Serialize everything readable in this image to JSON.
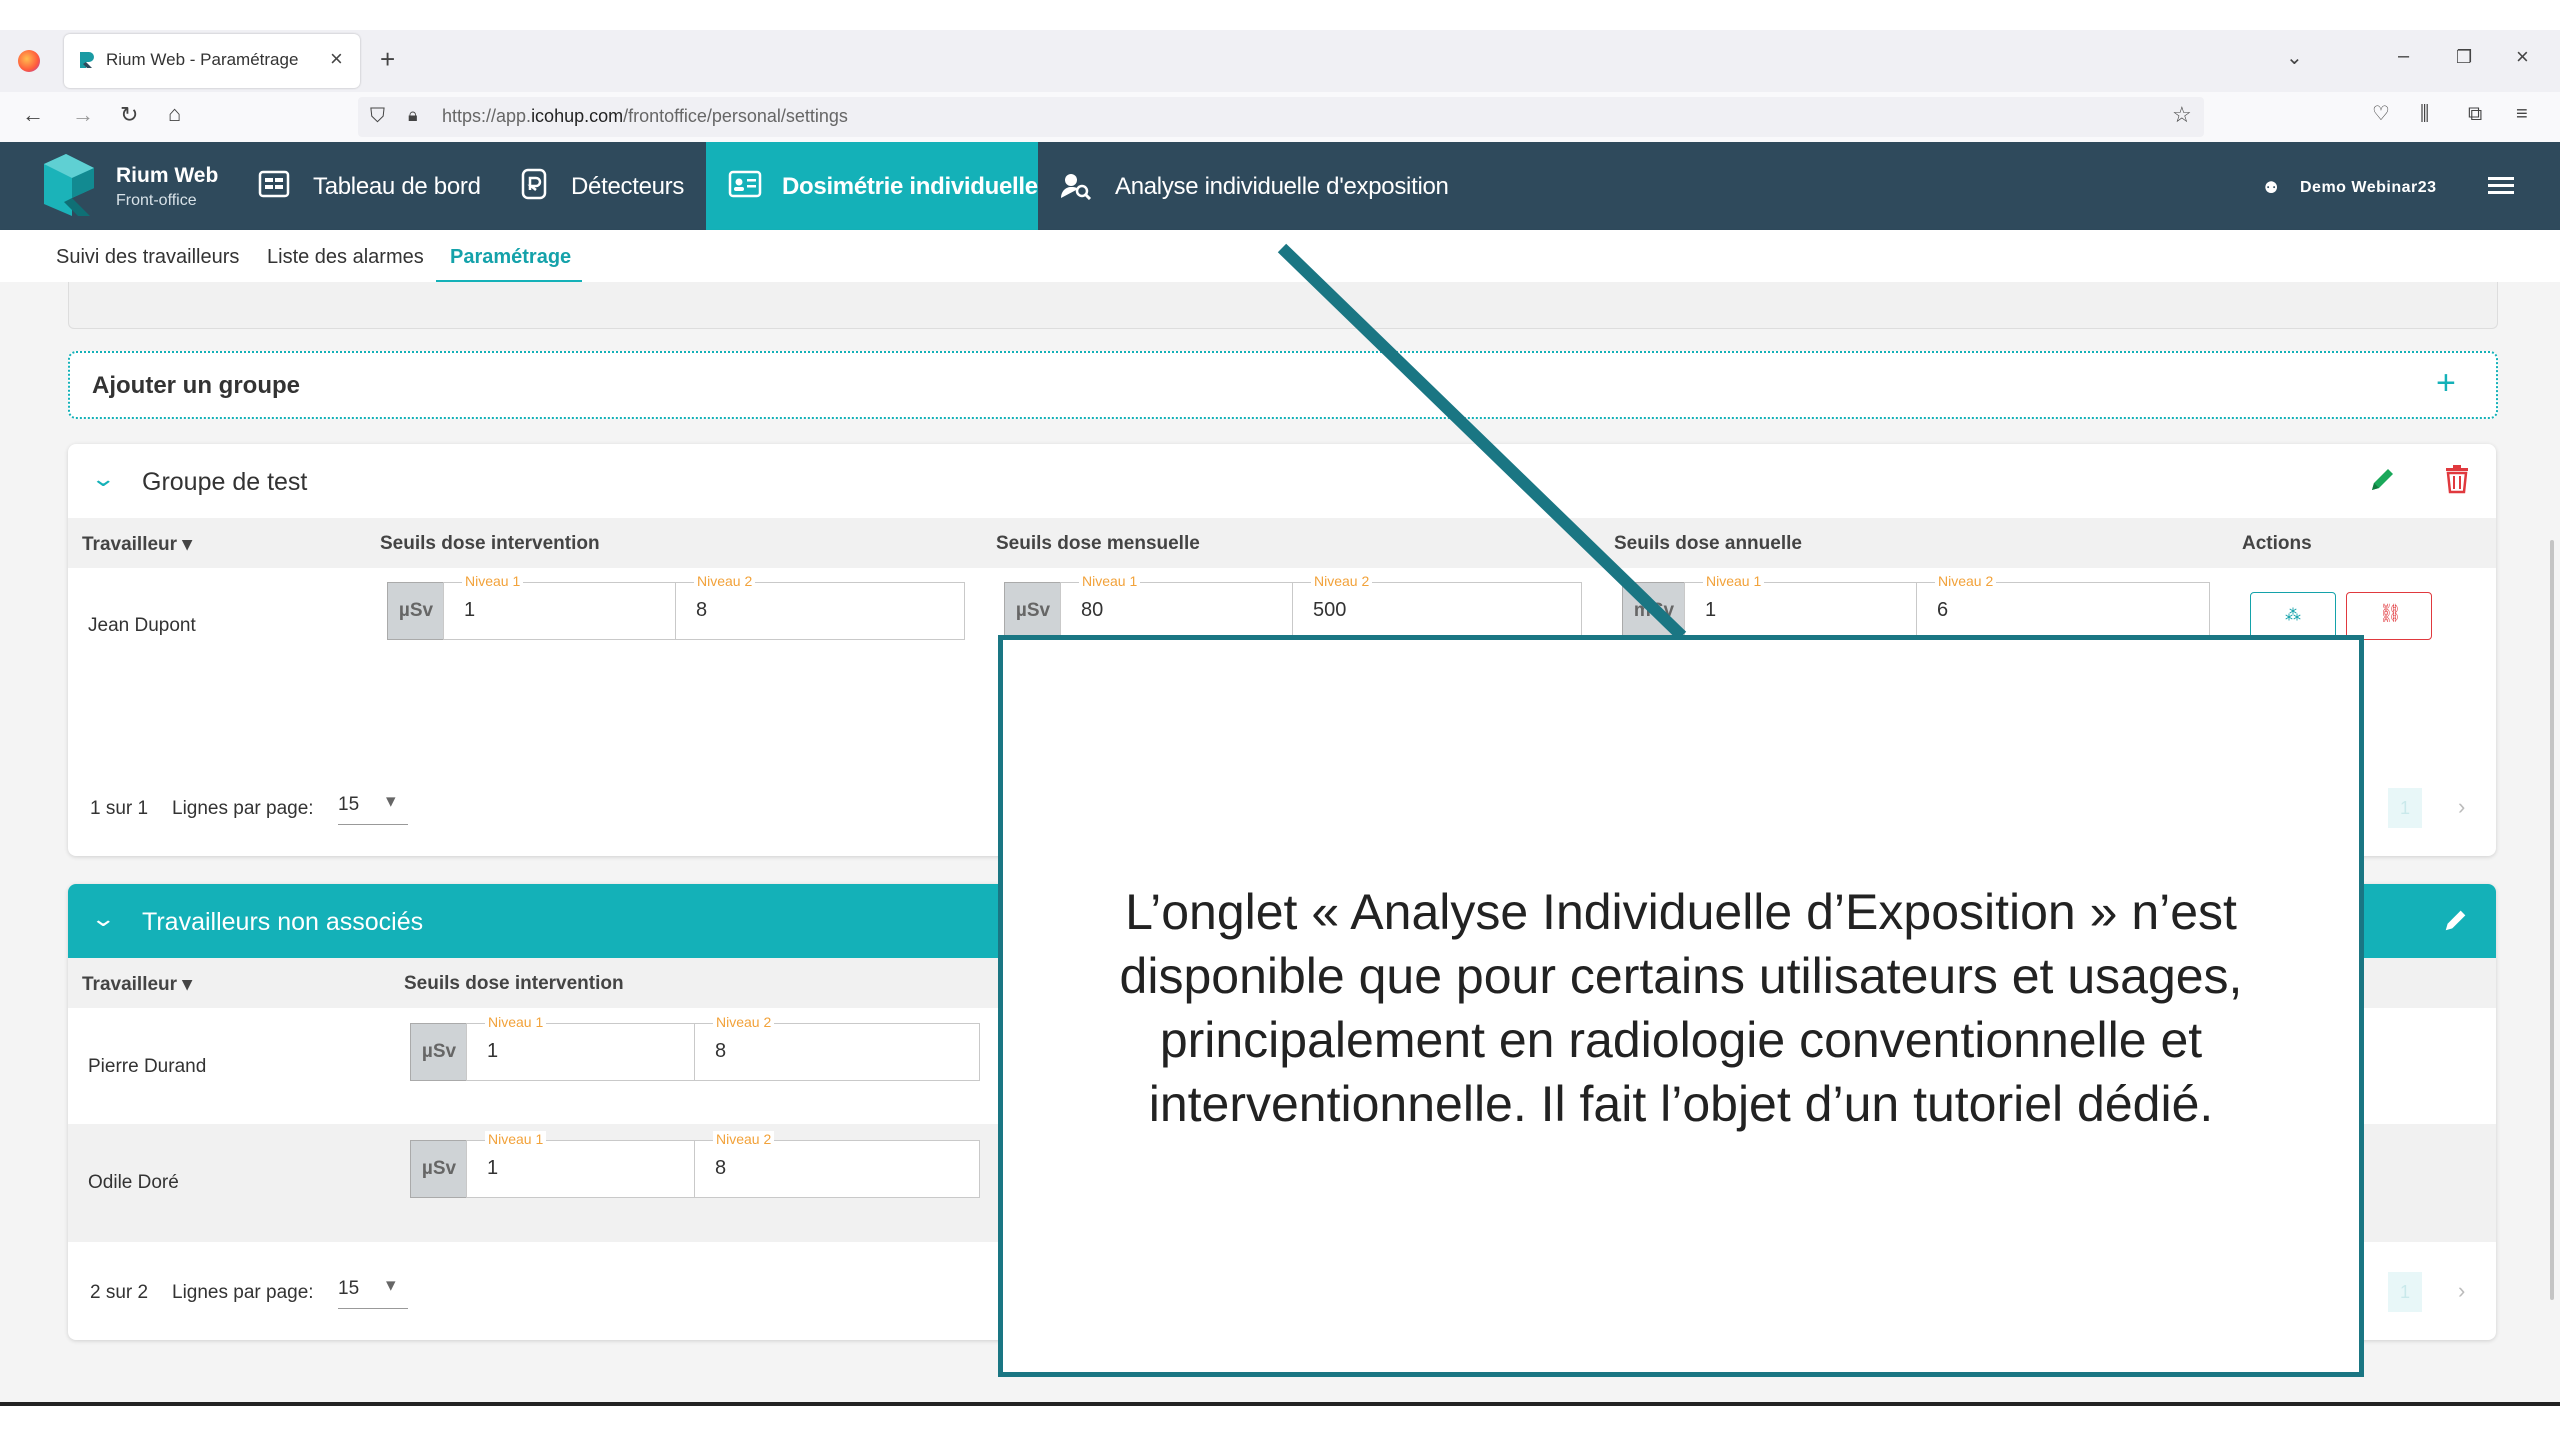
{
  "browser": {
    "tab_title": "Rium Web - Paramétrage",
    "url_prefix": "https://app.",
    "url_domain": "icohup.com",
    "url_path": "/frontoffice/personal/settings"
  },
  "app": {
    "brand_name": "Rium Web",
    "brand_sub": "Front-office",
    "nav": [
      {
        "label": "Tableau de bord",
        "icon": "dashboard-icon"
      },
      {
        "label": "Détecteurs",
        "icon": "detector-icon"
      },
      {
        "label": "Dosimétrie individuelle",
        "icon": "id-card-icon",
        "active": true
      },
      {
        "label": "Analyse individuelle d'exposition",
        "icon": "user-search-icon"
      }
    ],
    "user_label": "Demo Webinar23",
    "subnav": [
      "Suivi des travailleurs",
      "Liste des alarmes",
      "Paramétrage"
    ],
    "accent": "#14b1b8",
    "header_bg": "#2f4a5c"
  },
  "add_group": {
    "label": "Ajouter un groupe",
    "icon": "plus-icon"
  },
  "group_test": {
    "title": "Groupe de test",
    "headers": [
      "Travailleur",
      "Seuils dose intervention",
      "Seuils dose mensuelle",
      "Seuils dose annuelle",
      "Actions"
    ],
    "rows": [
      {
        "name": "Jean Dupont",
        "intervention": {
          "unit": "µSv",
          "n1_label": "Niveau 1",
          "n1": "1",
          "n2_label": "Niveau 2",
          "n2": "8"
        },
        "mensuelle": {
          "unit": "µSv",
          "n1_label": "Niveau 1",
          "n1": "80",
          "n2_label": "Niveau 2",
          "n2": "500"
        },
        "annuelle": {
          "unit": "mSv",
          "n1_label": "Niveau 1",
          "n1": "1",
          "n2_label": "Niveau 2",
          "n2": "6"
        }
      }
    ],
    "pagination": {
      "summary": "1 sur 1",
      "per_page_label": "Lignes par page:",
      "per_page": "15",
      "page": "1"
    }
  },
  "group_unassoc": {
    "title": "Travailleurs non associés",
    "headers": [
      "Travailleur",
      "Seuils dose intervention"
    ],
    "rows": [
      {
        "name": "Pierre Durand",
        "unit": "µSv",
        "n1_label": "Niveau 1",
        "n1": "1",
        "n2_label": "Niveau 2",
        "n2": "8"
      },
      {
        "name": "Odile Doré",
        "unit": "µSv",
        "n1_label": "Niveau 1",
        "n1": "1",
        "n2_label": "Niveau 2",
        "n2": "8"
      }
    ],
    "pagination": {
      "summary": "2 sur 2",
      "per_page_label": "Lignes par page:",
      "per_page": "15",
      "page": "1"
    }
  },
  "callout": {
    "text": "L’onglet « Analyse Individuelle d’Exposition » n’est disponible que pour certains utilisateurs et usages, principalement en radiologie conventionnelle et interventionnelle. Il fait l’objet d’un tutoriel dédié.",
    "border_color": "#1a7683"
  }
}
